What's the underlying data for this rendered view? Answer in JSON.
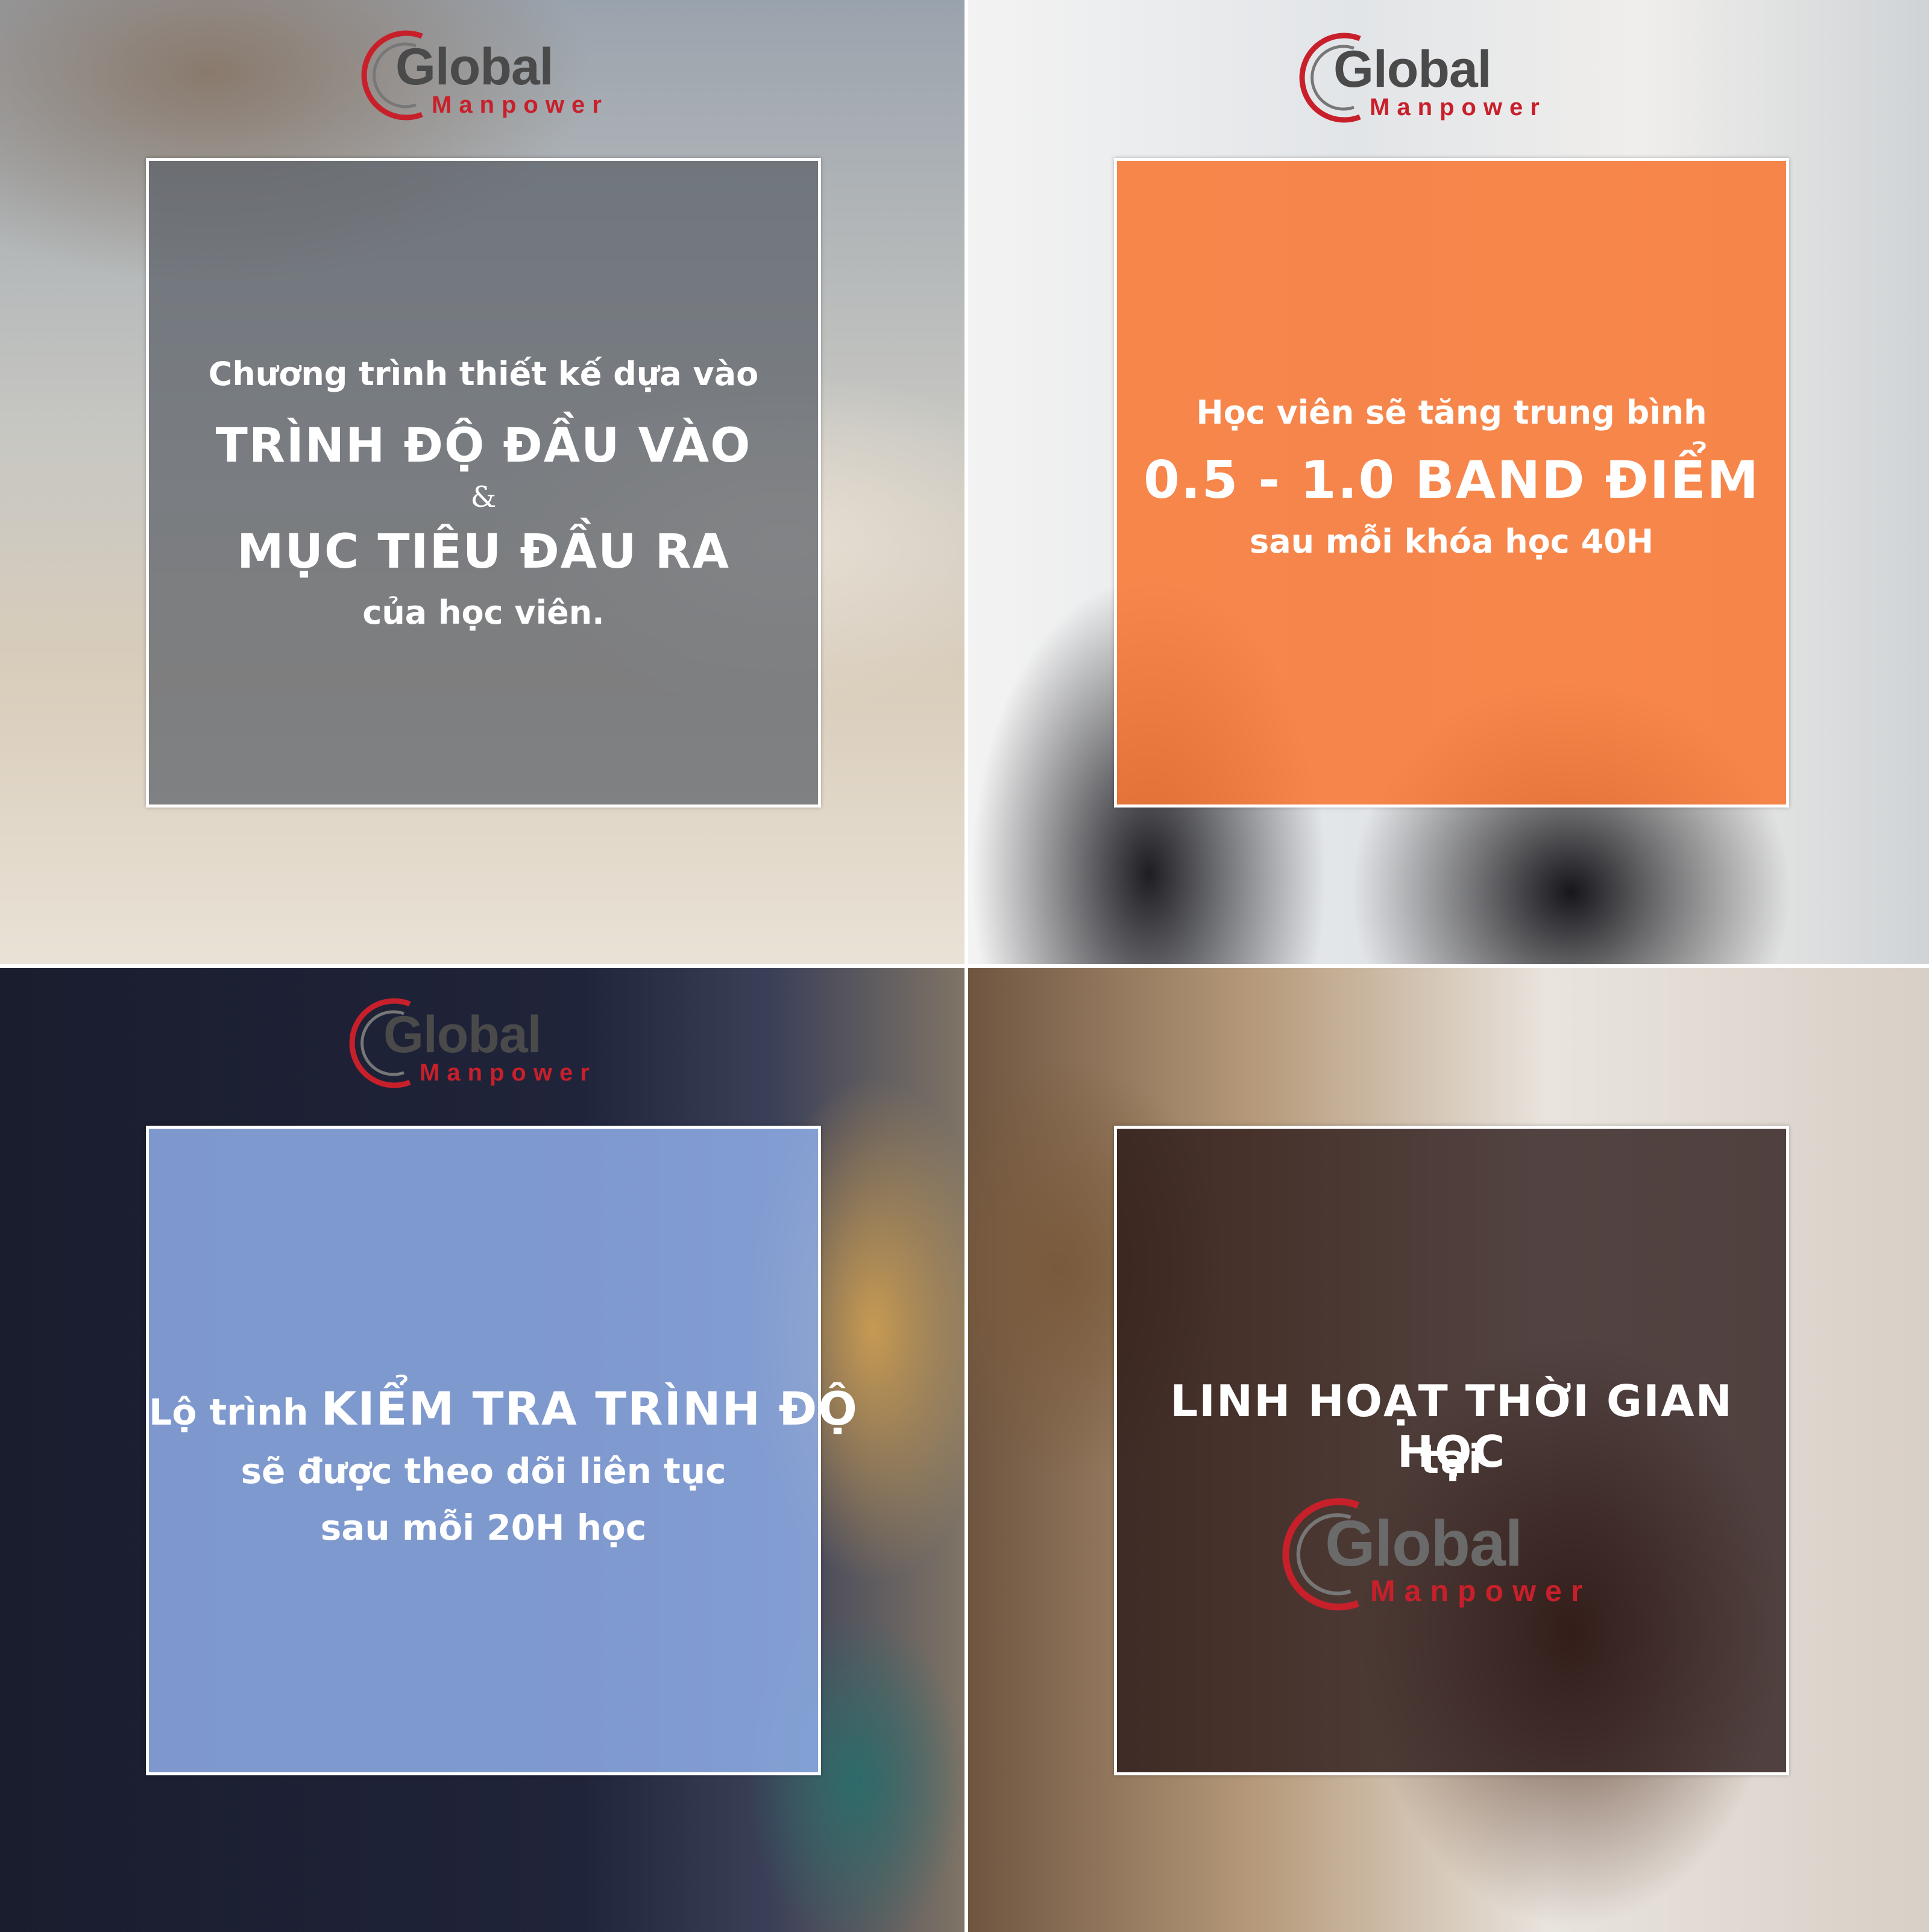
{
  "brand": {
    "name": "Global",
    "tagline": "Manpower",
    "colors": {
      "swoosh": "#c8202b",
      "wordmark": "#4a4a4a",
      "tagline": "#c8202b"
    }
  },
  "cards": [
    {
      "theme": "gray",
      "color": "#5a6068",
      "lines": {
        "intro": "Chương trình thiết kế dựa vào",
        "emphasis1": "TRÌNH ĐỘ ĐẦU VÀO",
        "connector": "&",
        "emphasis2": "MỤC TIÊU ĐẦU RA",
        "outro": "của học viên."
      }
    },
    {
      "theme": "orange",
      "color": "#f87834",
      "lines": {
        "intro": "Học viên sẽ tăng trung bình",
        "emphasis": "0.5 - 1.0 BAND ĐIỂM",
        "outro": "sau mỗi khóa học 40H"
      }
    },
    {
      "theme": "blue",
      "color": "#8caae2",
      "lines": {
        "prefix": "Lộ trình ",
        "emphasis": "KIỂM TRA TRÌNH ĐỘ",
        "line2": "sẽ được theo dõi liên tục",
        "line3": "sau mỗi 20H học"
      }
    },
    {
      "theme": "dark",
      "color": "#281616",
      "lines": {
        "emphasis": "LINH HOẠT THỜI GIAN HỌC",
        "line2": "tại"
      }
    }
  ]
}
